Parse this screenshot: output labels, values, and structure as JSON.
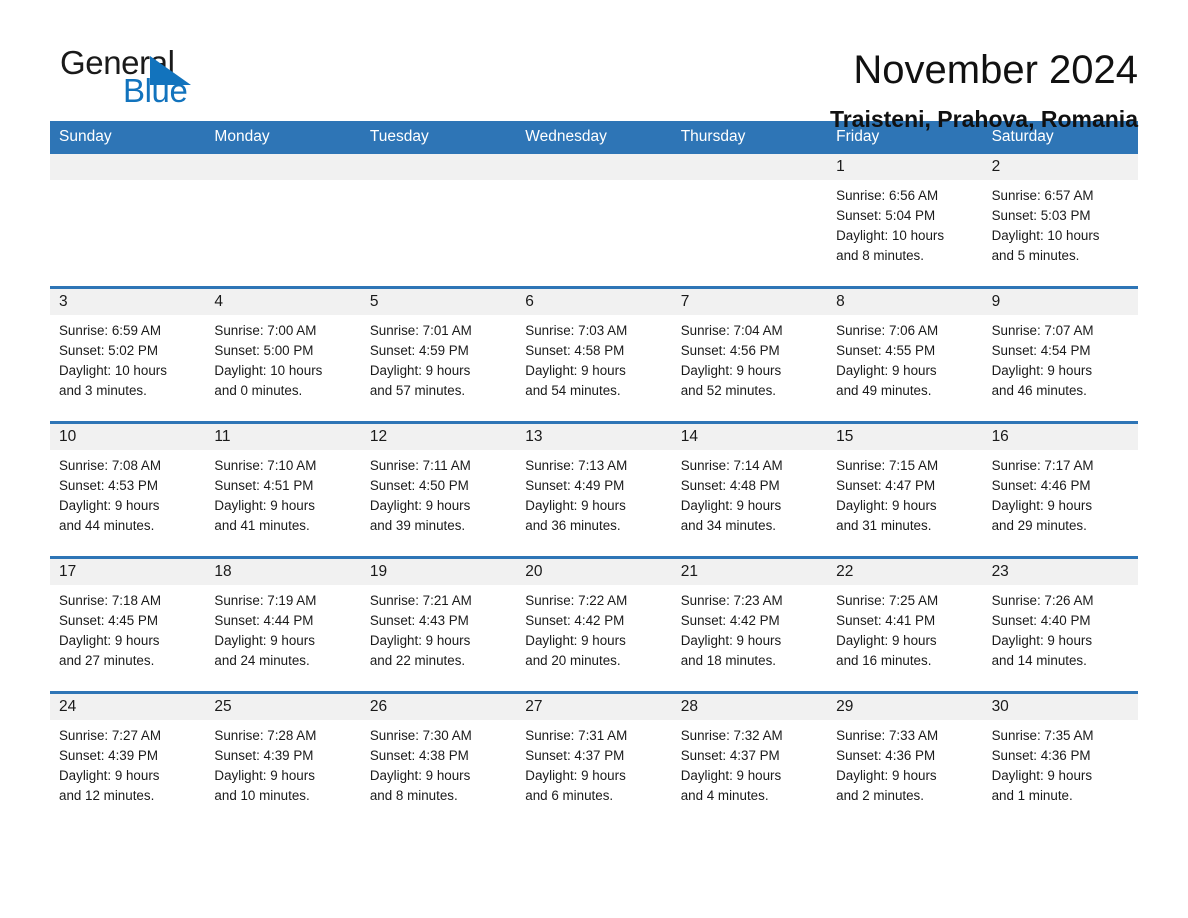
{
  "brand": {
    "name_part1": "General",
    "name_part2": "Blue",
    "accent_color": "#1273bd"
  },
  "header": {
    "title": "November 2024",
    "subtitle": "Traisteni, Prahova, Romania"
  },
  "calendar": {
    "header_bg": "#2e75b6",
    "day_band_bg": "#f1f1f1",
    "weekdays": [
      "Sunday",
      "Monday",
      "Tuesday",
      "Wednesday",
      "Thursday",
      "Friday",
      "Saturday"
    ],
    "weeks": [
      [
        {
          "day": "",
          "lines": []
        },
        {
          "day": "",
          "lines": []
        },
        {
          "day": "",
          "lines": []
        },
        {
          "day": "",
          "lines": []
        },
        {
          "day": "",
          "lines": []
        },
        {
          "day": "1",
          "lines": [
            "Sunrise: 6:56 AM",
            "Sunset: 5:04 PM",
            "Daylight: 10 hours",
            "and 8 minutes."
          ]
        },
        {
          "day": "2",
          "lines": [
            "Sunrise: 6:57 AM",
            "Sunset: 5:03 PM",
            "Daylight: 10 hours",
            "and 5 minutes."
          ]
        }
      ],
      [
        {
          "day": "3",
          "lines": [
            "Sunrise: 6:59 AM",
            "Sunset: 5:02 PM",
            "Daylight: 10 hours",
            "and 3 minutes."
          ]
        },
        {
          "day": "4",
          "lines": [
            "Sunrise: 7:00 AM",
            "Sunset: 5:00 PM",
            "Daylight: 10 hours",
            "and 0 minutes."
          ]
        },
        {
          "day": "5",
          "lines": [
            "Sunrise: 7:01 AM",
            "Sunset: 4:59 PM",
            "Daylight: 9 hours",
            "and 57 minutes."
          ]
        },
        {
          "day": "6",
          "lines": [
            "Sunrise: 7:03 AM",
            "Sunset: 4:58 PM",
            "Daylight: 9 hours",
            "and 54 minutes."
          ]
        },
        {
          "day": "7",
          "lines": [
            "Sunrise: 7:04 AM",
            "Sunset: 4:56 PM",
            "Daylight: 9 hours",
            "and 52 minutes."
          ]
        },
        {
          "day": "8",
          "lines": [
            "Sunrise: 7:06 AM",
            "Sunset: 4:55 PM",
            "Daylight: 9 hours",
            "and 49 minutes."
          ]
        },
        {
          "day": "9",
          "lines": [
            "Sunrise: 7:07 AM",
            "Sunset: 4:54 PM",
            "Daylight: 9 hours",
            "and 46 minutes."
          ]
        }
      ],
      [
        {
          "day": "10",
          "lines": [
            "Sunrise: 7:08 AM",
            "Sunset: 4:53 PM",
            "Daylight: 9 hours",
            "and 44 minutes."
          ]
        },
        {
          "day": "11",
          "lines": [
            "Sunrise: 7:10 AM",
            "Sunset: 4:51 PM",
            "Daylight: 9 hours",
            "and 41 minutes."
          ]
        },
        {
          "day": "12",
          "lines": [
            "Sunrise: 7:11 AM",
            "Sunset: 4:50 PM",
            "Daylight: 9 hours",
            "and 39 minutes."
          ]
        },
        {
          "day": "13",
          "lines": [
            "Sunrise: 7:13 AM",
            "Sunset: 4:49 PM",
            "Daylight: 9 hours",
            "and 36 minutes."
          ]
        },
        {
          "day": "14",
          "lines": [
            "Sunrise: 7:14 AM",
            "Sunset: 4:48 PM",
            "Daylight: 9 hours",
            "and 34 minutes."
          ]
        },
        {
          "day": "15",
          "lines": [
            "Sunrise: 7:15 AM",
            "Sunset: 4:47 PM",
            "Daylight: 9 hours",
            "and 31 minutes."
          ]
        },
        {
          "day": "16",
          "lines": [
            "Sunrise: 7:17 AM",
            "Sunset: 4:46 PM",
            "Daylight: 9 hours",
            "and 29 minutes."
          ]
        }
      ],
      [
        {
          "day": "17",
          "lines": [
            "Sunrise: 7:18 AM",
            "Sunset: 4:45 PM",
            "Daylight: 9 hours",
            "and 27 minutes."
          ]
        },
        {
          "day": "18",
          "lines": [
            "Sunrise: 7:19 AM",
            "Sunset: 4:44 PM",
            "Daylight: 9 hours",
            "and 24 minutes."
          ]
        },
        {
          "day": "19",
          "lines": [
            "Sunrise: 7:21 AM",
            "Sunset: 4:43 PM",
            "Daylight: 9 hours",
            "and 22 minutes."
          ]
        },
        {
          "day": "20",
          "lines": [
            "Sunrise: 7:22 AM",
            "Sunset: 4:42 PM",
            "Daylight: 9 hours",
            "and 20 minutes."
          ]
        },
        {
          "day": "21",
          "lines": [
            "Sunrise: 7:23 AM",
            "Sunset: 4:42 PM",
            "Daylight: 9 hours",
            "and 18 minutes."
          ]
        },
        {
          "day": "22",
          "lines": [
            "Sunrise: 7:25 AM",
            "Sunset: 4:41 PM",
            "Daylight: 9 hours",
            "and 16 minutes."
          ]
        },
        {
          "day": "23",
          "lines": [
            "Sunrise: 7:26 AM",
            "Sunset: 4:40 PM",
            "Daylight: 9 hours",
            "and 14 minutes."
          ]
        }
      ],
      [
        {
          "day": "24",
          "lines": [
            "Sunrise: 7:27 AM",
            "Sunset: 4:39 PM",
            "Daylight: 9 hours",
            "and 12 minutes."
          ]
        },
        {
          "day": "25",
          "lines": [
            "Sunrise: 7:28 AM",
            "Sunset: 4:39 PM",
            "Daylight: 9 hours",
            "and 10 minutes."
          ]
        },
        {
          "day": "26",
          "lines": [
            "Sunrise: 7:30 AM",
            "Sunset: 4:38 PM",
            "Daylight: 9 hours",
            "and 8 minutes."
          ]
        },
        {
          "day": "27",
          "lines": [
            "Sunrise: 7:31 AM",
            "Sunset: 4:37 PM",
            "Daylight: 9 hours",
            "and 6 minutes."
          ]
        },
        {
          "day": "28",
          "lines": [
            "Sunrise: 7:32 AM",
            "Sunset: 4:37 PM",
            "Daylight: 9 hours",
            "and 4 minutes."
          ]
        },
        {
          "day": "29",
          "lines": [
            "Sunrise: 7:33 AM",
            "Sunset: 4:36 PM",
            "Daylight: 9 hours",
            "and 2 minutes."
          ]
        },
        {
          "day": "30",
          "lines": [
            "Sunrise: 7:35 AM",
            "Sunset: 4:36 PM",
            "Daylight: 9 hours",
            "and 1 minute."
          ]
        }
      ]
    ]
  }
}
